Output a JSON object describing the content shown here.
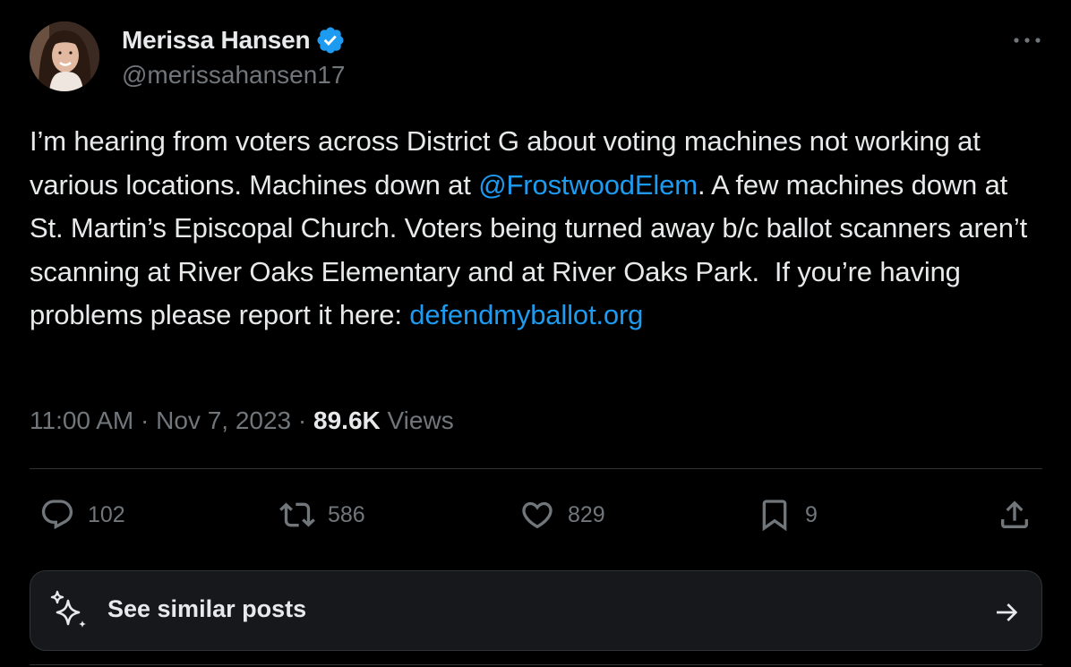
{
  "author": {
    "display_name": "Merissa Hansen",
    "handle": "@merissahansen17",
    "verified": true
  },
  "tweet": {
    "text_part1": "I’m hearing from voters across District G about voting machines not working at various locations. Machines down at ",
    "mention": "@FrostwoodElem",
    "text_part2": ". A few machines down at St. Martin’s Episcopal Church. Voters being turned away b/c ballot scanners aren’t scanning at River Oaks Elementary and at River Oaks Park.  If you’re having problems please report it here: ",
    "link": "defendmyballot.org"
  },
  "meta": {
    "time": "11:00 AM",
    "separator": " · ",
    "date": "Nov 7, 2023",
    "views_count": "89.6K",
    "views_label": " Views"
  },
  "actions": {
    "replies": "102",
    "reposts": "586",
    "likes": "829",
    "bookmarks": "9"
  },
  "similar": {
    "label": "See similar posts"
  },
  "colors": {
    "background": "#000000",
    "text": "#e7e9ea",
    "secondary": "#71767b",
    "link": "#1d9bf0",
    "verified": "#1d9bf0",
    "divider": "#2f3336"
  },
  "icons": [
    "verified-badge-icon",
    "more-icon",
    "reply-icon",
    "repost-icon",
    "like-icon",
    "bookmark-icon",
    "share-icon",
    "sparkle-icon",
    "arrow-right-icon"
  ]
}
